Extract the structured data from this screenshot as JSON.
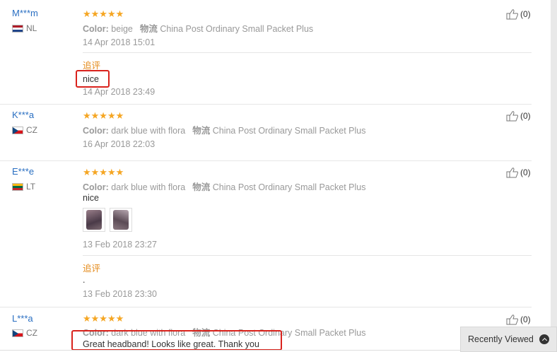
{
  "reviews": [
    {
      "user": "M***m",
      "country": "NL",
      "flag": "nl",
      "color_label": "Color:",
      "color": "beige",
      "shipping_label": "物流",
      "shipping": "China Post Ordinary Small Packet Plus",
      "date": "14 Apr 2018 15:01",
      "followup_label": "追评",
      "followup_text": "nice",
      "followup_date": "14 Apr 2018 23:49",
      "helpful": "(0)"
    },
    {
      "user": "K***a",
      "country": "CZ",
      "flag": "cz",
      "color_label": "Color:",
      "color": "dark blue with flora",
      "shipping_label": "物流",
      "shipping": "China Post Ordinary Small Packet Plus",
      "date": "16 Apr 2018 22:03",
      "helpful": "(0)"
    },
    {
      "user": "E***e",
      "country": "LT",
      "flag": "lt",
      "color_label": "Color:",
      "color": "dark blue with flora",
      "shipping_label": "物流",
      "shipping": "China Post Ordinary Small Packet Plus",
      "text": "nice",
      "date": "13 Feb 2018 23:27",
      "followup_label": "追评",
      "followup_text": ".",
      "followup_date": "13 Feb 2018 23:30",
      "helpful": "(0)"
    },
    {
      "user": "L***a",
      "country": "CZ",
      "flag": "cz",
      "color_label": "Color:",
      "color": "dark blue with flora",
      "shipping_label": "物流",
      "shipping": "China Post Ordinary Small Packet Plus",
      "text": "Great headband! Looks like great. Thank you",
      "helpful": "(0)"
    }
  ],
  "stars": "★★★★★",
  "recently_viewed": "Recently Viewed",
  "colors": {
    "accent_orange": "#e48a1a",
    "star": "#f5a623",
    "user_blue": "#2a6fc2",
    "highlight_red": "#d9221c"
  }
}
